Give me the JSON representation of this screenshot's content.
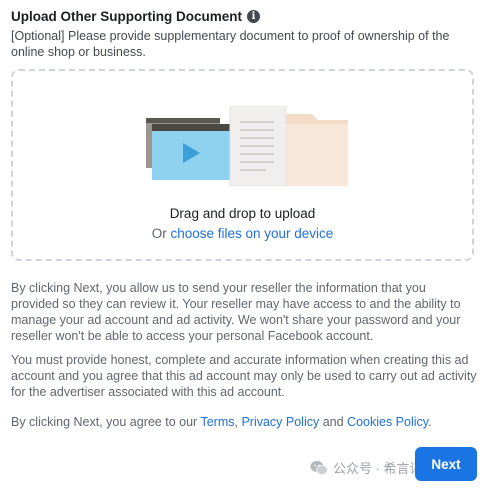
{
  "header": {
    "title": "Upload Other Supporting Document",
    "info_icon": "info-icon",
    "info_glyph": "i",
    "subtitle": "[Optional] Please provide supplementary document to proof of ownership of the online shop or business."
  },
  "dropzone": {
    "illustration": "media-document-folder-illustration",
    "main_text": "Drag and drop to upload",
    "or_text": "Or ",
    "choose_link": "choose files on your device"
  },
  "disclaimer": {
    "p1": "By clicking Next, you allow us to send your reseller the information that you provided so they can review it. Your reseller may have access to and the ability to manage your ad account and ad activity. We won't share your password and your reseller won't be able to access your personal Facebook account.",
    "p2": "You must provide honest, complete and accurate information when creating this ad account and you agree that this ad account may only be used to carry out ad activity for the advertiser associated with this ad account.",
    "p3_prefix": "By clicking Next, you agree to our ",
    "terms": "Terms",
    "comma": ", ",
    "privacy": "Privacy Policy",
    "and": " and ",
    "cookies": "Cookies Policy",
    "period": "."
  },
  "footer": {
    "next_label": "Next"
  },
  "watermark": {
    "icon": "wechat-icon",
    "text": "公众号 · 希言评念"
  },
  "colors": {
    "link": "#216fdb",
    "button": "#1b74e4",
    "dashed_border": "#d0d3d7"
  }
}
